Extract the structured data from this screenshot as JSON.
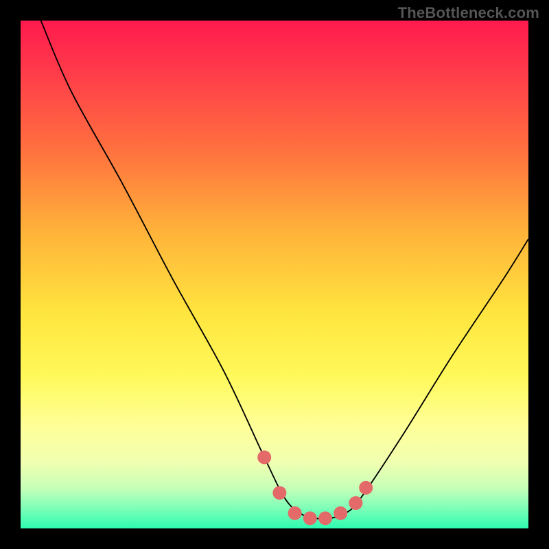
{
  "watermark": "TheBottleneck.com",
  "chart_data": {
    "type": "line",
    "title": "",
    "xlabel": "",
    "ylabel": "",
    "xlim": [
      0,
      100
    ],
    "ylim": [
      0,
      100
    ],
    "series": [
      {
        "name": "bottleneck-curve",
        "x": [
          4,
          10,
          20,
          30,
          40,
          48,
          52,
          55,
          58,
          61,
          64,
          67,
          75,
          85,
          95,
          100
        ],
        "y": [
          100,
          86,
          68,
          49,
          31,
          14,
          6,
          3,
          2,
          2,
          3,
          6,
          18,
          34,
          49,
          57
        ]
      }
    ],
    "markers": {
      "name": "highlight-dots",
      "color": "#e46a6a",
      "x": [
        48,
        51,
        54,
        57,
        60,
        63,
        66,
        68
      ],
      "y": [
        14,
        7,
        3,
        2,
        2,
        3,
        5,
        8
      ]
    },
    "gradient_stops": [
      {
        "pos": 0,
        "color": "#ff1a4d"
      },
      {
        "pos": 25,
        "color": "#ff6f3f"
      },
      {
        "pos": 58,
        "color": "#ffe63f"
      },
      {
        "pos": 80,
        "color": "#ffff99"
      },
      {
        "pos": 100,
        "color": "#2dfcb0"
      }
    ]
  }
}
